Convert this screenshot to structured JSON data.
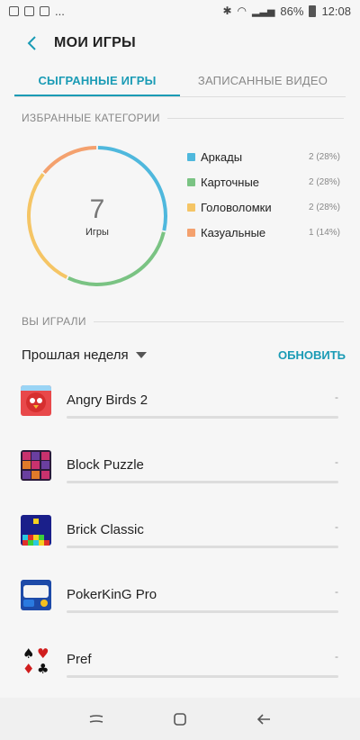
{
  "status_bar": {
    "dots": "...",
    "battery": "86%",
    "time": "12:08"
  },
  "header": {
    "title": "МОИ ИГРЫ"
  },
  "tabs": [
    {
      "label": "СЫГРАННЫЕ ИГРЫ",
      "active": true
    },
    {
      "label": "ЗАПИСАННЫЕ ВИДЕО",
      "active": false
    }
  ],
  "favorites": {
    "section_title": "ИЗБРАННЫЕ КАТЕГОРИИ",
    "total": "7",
    "total_label": "Игры",
    "categories": [
      {
        "name": "Аркады",
        "count": "2 (28%)",
        "color": "#4fb8dd",
        "fraction": 0.28
      },
      {
        "name": "Карточные",
        "count": "2 (28%)",
        "color": "#7ac383",
        "fraction": 0.28
      },
      {
        "name": "Головоломки",
        "count": "2 (28%)",
        "color": "#f5c565",
        "fraction": 0.28
      },
      {
        "name": "Казуальные",
        "count": "1 (14%)",
        "color": "#f4a16e",
        "fraction": 0.14
      }
    ]
  },
  "played": {
    "section_title": "ВЫ ИГРАЛИ",
    "period": "Прошлая неделя",
    "refresh": "ОБНОВИТЬ",
    "games": [
      {
        "name": "Angry Birds 2",
        "time": "-"
      },
      {
        "name": "Block Puzzle",
        "time": "-"
      },
      {
        "name": "Brick Classic",
        "time": "-"
      },
      {
        "name": "PokerKinG Pro",
        "time": "-"
      },
      {
        "name": "Pref",
        "time": "-"
      }
    ]
  }
}
